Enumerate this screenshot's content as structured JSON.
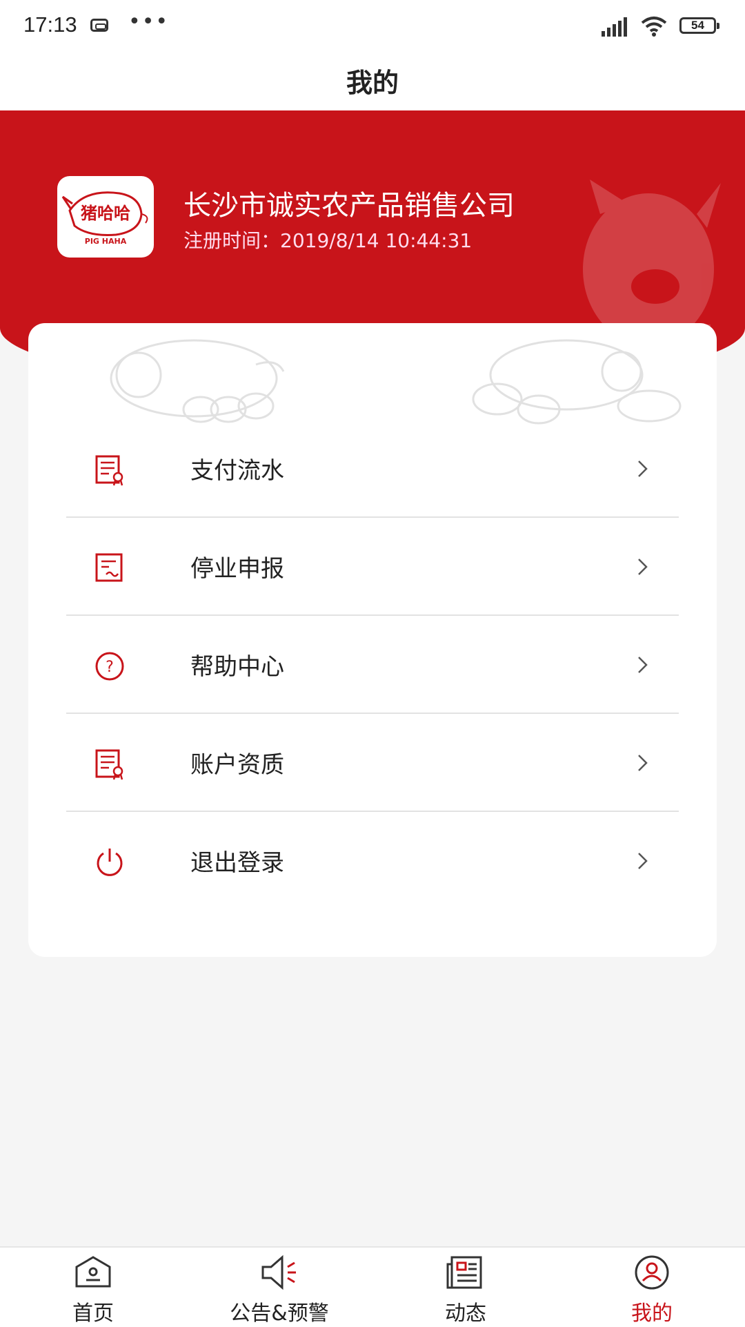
{
  "status_bar": {
    "time": "17:13",
    "battery": "54"
  },
  "header": {
    "title": "我的"
  },
  "profile": {
    "company_name": "长沙市诚实农产品销售公司",
    "registration": "注册时间：2019/8/14 10:44:31",
    "logo_text": "猪哈哈",
    "logo_subtext": "PIG HAHA"
  },
  "menu": {
    "items": [
      {
        "label": "支付流水",
        "icon": "payment-record-icon"
      },
      {
        "label": "停业申报",
        "icon": "suspension-report-icon"
      },
      {
        "label": "帮助中心",
        "icon": "help-icon"
      },
      {
        "label": "账户资质",
        "icon": "account-qualification-icon"
      },
      {
        "label": "退出登录",
        "icon": "power-icon"
      }
    ]
  },
  "bottom_nav": {
    "items": [
      {
        "label": "首页",
        "icon": "home-icon"
      },
      {
        "label": "公告&预警",
        "icon": "megaphone-icon"
      },
      {
        "label": "动态",
        "icon": "news-icon"
      },
      {
        "label": "我的",
        "icon": "user-icon",
        "active": true
      }
    ]
  },
  "colors": {
    "accent": "#c8141a",
    "background": "#f5f5f5",
    "card": "#ffffff"
  }
}
